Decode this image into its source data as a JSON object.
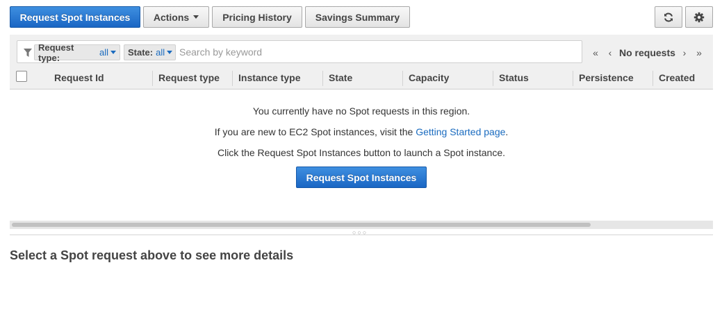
{
  "toolbar": {
    "request_spot_label": "Request Spot Instances",
    "actions_label": "Actions",
    "pricing_history_label": "Pricing History",
    "savings_summary_label": "Savings Summary",
    "refresh_icon": "refresh-icon",
    "settings_icon": "gear-icon"
  },
  "filter": {
    "request_type_label": "Request type:",
    "request_type_value": "all",
    "state_label": "State:",
    "state_value": "all",
    "search_placeholder": "Search by keyword"
  },
  "pagination": {
    "status": "No requests"
  },
  "table": {
    "columns": [
      "Request Id",
      "Request type",
      "Instance type",
      "State",
      "Capacity",
      "Status",
      "Persistence",
      "Created"
    ]
  },
  "empty_state": {
    "line1": "You currently have no Spot requests in this region.",
    "line2_prefix": "If you are new to EC2 Spot instances, visit the ",
    "line2_link": "Getting Started page",
    "line2_suffix": ".",
    "line3": "Click the Request Spot Instances button to launch a Spot instance.",
    "button_label": "Request Spot Instances"
  },
  "details": {
    "placeholder": "Select a Spot request above to see more details"
  },
  "colors": {
    "primary": "#1a66c4",
    "link": "#1a6bbf",
    "header_bg": "#f0f0f0"
  }
}
